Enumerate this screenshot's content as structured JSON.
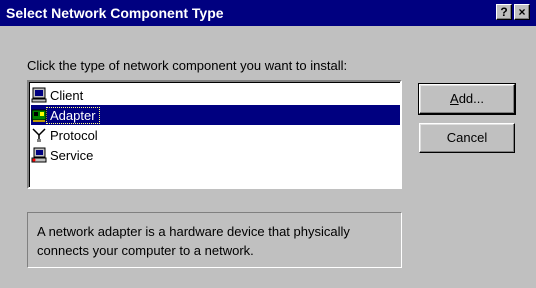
{
  "window": {
    "title": "Select Network Component Type",
    "help_label": "?",
    "close_label": "×"
  },
  "prompt": "Click the type of network component you want to install:",
  "components": [
    {
      "label": "Client",
      "icon": "client-computer-icon",
      "selected": false
    },
    {
      "label": "Adapter",
      "icon": "network-adapter-icon",
      "selected": true
    },
    {
      "label": "Protocol",
      "icon": "protocol-icon",
      "selected": false
    },
    {
      "label": "Service",
      "icon": "service-icon",
      "selected": false
    }
  ],
  "buttons": {
    "add_label_accel": "A",
    "add_label_rest": "dd...",
    "cancel_label": "Cancel"
  },
  "description": "A network adapter is a hardware device that physically connects your computer to a network.",
  "colors": {
    "titlebar": "#000080",
    "face": "#c0c0c0",
    "selection": "#000080"
  }
}
